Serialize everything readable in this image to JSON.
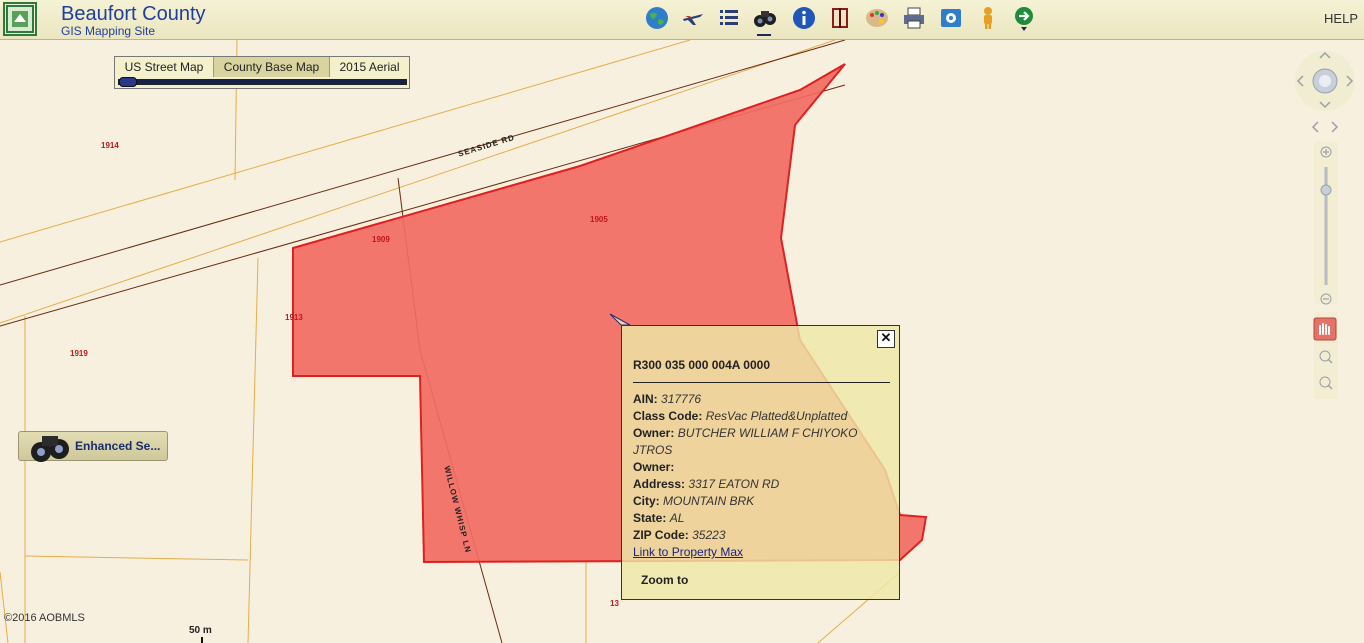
{
  "header": {
    "title": "Beaufort County",
    "subtitle": "GIS Mapping Site",
    "help_label": "HELP"
  },
  "toolbar": {
    "tools": [
      "globe-icon",
      "plane-icon",
      "layers-list-icon",
      "binoculars-icon",
      "info-icon",
      "book-icon",
      "palette-icon",
      "printer-icon",
      "settings-box-icon",
      "person-icon",
      "arrow-menu-icon"
    ],
    "active_tool": "binoculars-icon"
  },
  "basemap": {
    "options": [
      "US Street Map",
      "County Base Map",
      "2015 Aerial"
    ],
    "selected": "County Base Map"
  },
  "enhanced_search": {
    "label": "Enhanced Se..."
  },
  "map_labels": {
    "parcels": [
      "1914",
      "1909",
      "1905",
      "1913",
      "1919",
      "13"
    ],
    "streets": [
      "SEASIDE RD",
      "WILLOW WHISP LN"
    ]
  },
  "popup": {
    "title": "R300 035 000 004A 0000",
    "fields": [
      {
        "label": "AIN:",
        "value": "317776"
      },
      {
        "label": "Class Code:",
        "value": "ResVac Platted&Unplatted"
      },
      {
        "label": "Owner:",
        "value": "BUTCHER WILLIAM F CHIYOKO JTROS"
      },
      {
        "label": "Owner:",
        "value": ""
      },
      {
        "label": "Address:",
        "value": "3317 EATON RD"
      },
      {
        "label": "City:",
        "value": "MOUNTAIN BRK"
      },
      {
        "label": "State:",
        "value": "AL"
      },
      {
        "label": "ZIP Code:",
        "value": "35223"
      }
    ],
    "link_label": "Link to Property Max",
    "zoom_label": "Zoom to",
    "close_symbol": "✕"
  },
  "footer": {
    "copyright": "©2016 AOBMLS",
    "scale": "50 m"
  },
  "colors": {
    "selected_parcel_fill": "#f26b62",
    "selected_parcel_stroke": "#e02020",
    "parcel_line": "#e6ad4a",
    "road_line": "#6a2a10",
    "header_title": "#1f3f9c"
  }
}
